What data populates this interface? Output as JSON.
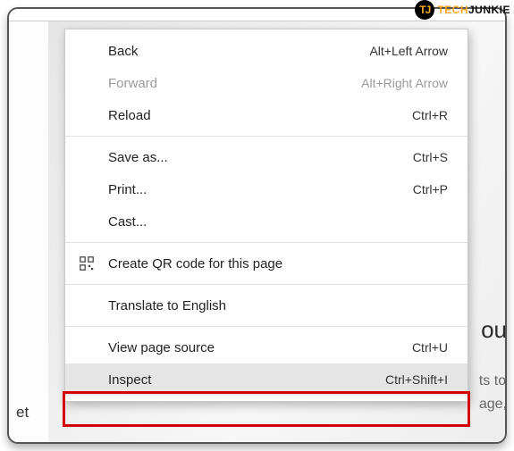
{
  "watermark": {
    "logo": "TJ",
    "part1": "TECH",
    "part2": "JUNKIE"
  },
  "background": {
    "headline_fragment": "ou",
    "sub_line1": "ts to",
    "sub_line2": "age,",
    "left_fragment": "et"
  },
  "menu": {
    "back": {
      "label": "Back",
      "shortcut": "Alt+Left Arrow"
    },
    "forward": {
      "label": "Forward",
      "shortcut": "Alt+Right Arrow"
    },
    "reload": {
      "label": "Reload",
      "shortcut": "Ctrl+R"
    },
    "saveas": {
      "label": "Save as...",
      "shortcut": "Ctrl+S"
    },
    "print": {
      "label": "Print...",
      "shortcut": "Ctrl+P"
    },
    "cast": {
      "label": "Cast...",
      "shortcut": ""
    },
    "qr": {
      "label": "Create QR code for this page",
      "shortcut": ""
    },
    "translate": {
      "label": "Translate to English",
      "shortcut": ""
    },
    "viewsrc": {
      "label": "View page source",
      "shortcut": "Ctrl+U"
    },
    "inspect": {
      "label": "Inspect",
      "shortcut": "Ctrl+Shift+I"
    }
  }
}
